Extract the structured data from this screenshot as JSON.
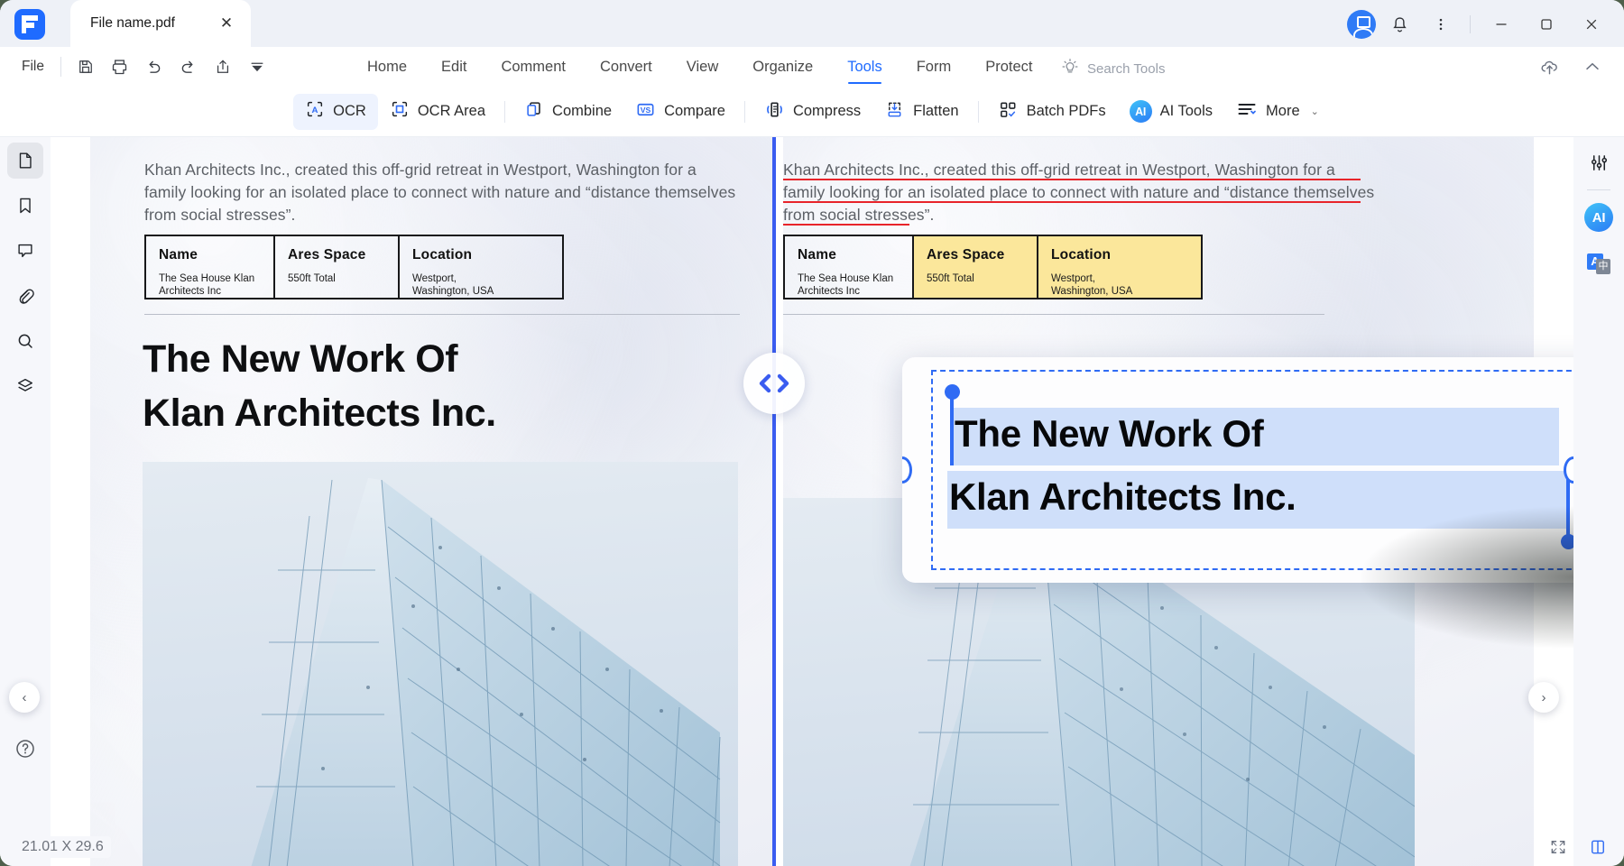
{
  "window": {
    "title_tab": "File name.pdf",
    "tab_close": "✕",
    "minimize": "─",
    "maximize": "▢",
    "close": "✕",
    "accent": "#1f6bff",
    "highlight_yellow": "#fbe79b",
    "underline_red": "#e8242a",
    "selection_blue": "#2f6bf4"
  },
  "titlebar": {
    "avatar_name": "account-avatar",
    "notification_name": "bell-icon",
    "more_name": "more-vertical-icon"
  },
  "menurow": {
    "file_label": "File",
    "quick_actions": [
      {
        "name": "save-icon"
      },
      {
        "name": "print-icon"
      },
      {
        "name": "undo-icon"
      },
      {
        "name": "redo-icon"
      },
      {
        "name": "share-icon"
      },
      {
        "name": "caret-down-icon"
      }
    ],
    "tabs": [
      {
        "label": "Home",
        "active": false
      },
      {
        "label": "Edit",
        "active": false
      },
      {
        "label": "Comment",
        "active": false
      },
      {
        "label": "Convert",
        "active": false
      },
      {
        "label": "View",
        "active": false
      },
      {
        "label": "Organize",
        "active": false
      },
      {
        "label": "Tools",
        "active": true
      },
      {
        "label": "Form",
        "active": false
      },
      {
        "label": "Protect",
        "active": false
      }
    ],
    "search": {
      "placeholder": "Search Tools",
      "icon": "lightbulb-icon"
    },
    "right_icons": [
      {
        "name": "cloud-upload-icon"
      },
      {
        "name": "collapse-ribbon-icon"
      }
    ]
  },
  "ribbon": {
    "tools": [
      {
        "label": "OCR",
        "icon": "ocr-icon",
        "active": true
      },
      {
        "label": "OCR Area",
        "icon": "ocr-area-icon",
        "active": false
      },
      {
        "label": "Combine",
        "icon": "combine-icon",
        "active": false
      },
      {
        "label": "Compare",
        "icon": "compare-vs-icon",
        "active": false
      },
      {
        "label": "Compress",
        "icon": "compress-icon",
        "active": false
      },
      {
        "label": "Flatten",
        "icon": "flatten-icon",
        "active": false
      },
      {
        "label": "Batch PDFs",
        "icon": "batch-pdfs-icon",
        "active": false
      },
      {
        "label": "AI Tools",
        "icon": "ai-badge-icon",
        "active": false
      },
      {
        "label": "More",
        "icon": "more-lines-icon",
        "active": false,
        "chevron": "⌄"
      }
    ]
  },
  "left_rail": {
    "items": [
      {
        "name": "thumbnails-icon",
        "active": true
      },
      {
        "name": "bookmark-icon",
        "active": false
      },
      {
        "name": "comment-icon",
        "active": false
      },
      {
        "name": "attachment-icon",
        "active": false
      },
      {
        "name": "search-icon",
        "active": false
      },
      {
        "name": "layers-icon",
        "active": false
      }
    ],
    "help": {
      "name": "help-icon",
      "label": "?"
    }
  },
  "right_rail": {
    "items": [
      {
        "name": "properties-sliders-icon"
      },
      {
        "name": "ai-assistant-icon",
        "label": "AI"
      },
      {
        "name": "translate-icon",
        "label_primary": "A",
        "label_secondary": "中"
      }
    ]
  },
  "document": {
    "left_page": {
      "paragraph_lines": [
        "Khan Architects Inc., created this off-grid retreat in Westport, Washington for a",
        "family looking for an isolated place to connect with nature and “distance themselves",
        "from social stresses”."
      ],
      "table": {
        "headers": [
          "Name",
          "Ares Space",
          "Location"
        ],
        "rows": [
          [
            "The Sea House Klan\nArchitects Inc",
            "550ft Total",
            "Westport,\nWashington, USA"
          ]
        ],
        "cell_name": "The Sea House Klan Architects Inc",
        "cell_area": "550ft Total",
        "cell_location_line1": "Westport,",
        "cell_location_line2": "Washington, USA",
        "highlighted_columns": []
      },
      "headline_line1": "The New Work Of",
      "headline_line2": "Klan Architects Inc.",
      "image_caption": "architectural-render-building"
    },
    "right_page": {
      "paragraph_lines": [
        "Khan Architects Inc., created this off-grid retreat in Westport, Washington for a",
        "family looking for an isolated place to connect with nature and “distance themselves",
        "from social stresses”."
      ],
      "paragraph_underlined": true,
      "table": {
        "headers": [
          "Name",
          "Ares Space",
          "Location"
        ],
        "cell_name": "The Sea House Klan\nArchitects Inc",
        "cell_name_line1": "The Sea House Klan",
        "cell_name_line2": "Architects Inc",
        "cell_area": "550ft Total",
        "cell_location_line1": "Westport,",
        "cell_location_line2": "Washington, USA",
        "highlighted_columns": [
          "Ares Space",
          "Location"
        ]
      }
    },
    "compare_divider": {
      "name": "compare-split-handle",
      "glyph": "< >"
    }
  },
  "selection_card": {
    "text_line1": "The New Work Of",
    "text_line2": "Klan Architects Inc.",
    "handles": [
      "cursor-start-handle",
      "cursor-end-handle",
      "resize-left-handle",
      "resize-right-handle"
    ]
  },
  "navigation": {
    "prev_label": "‹",
    "next_label": "›"
  },
  "statusbar": {
    "page_size": "21.01 X 29.6",
    "right_icons": [
      {
        "name": "fit-page-icon"
      },
      {
        "name": "single-page-view-icon"
      }
    ]
  }
}
